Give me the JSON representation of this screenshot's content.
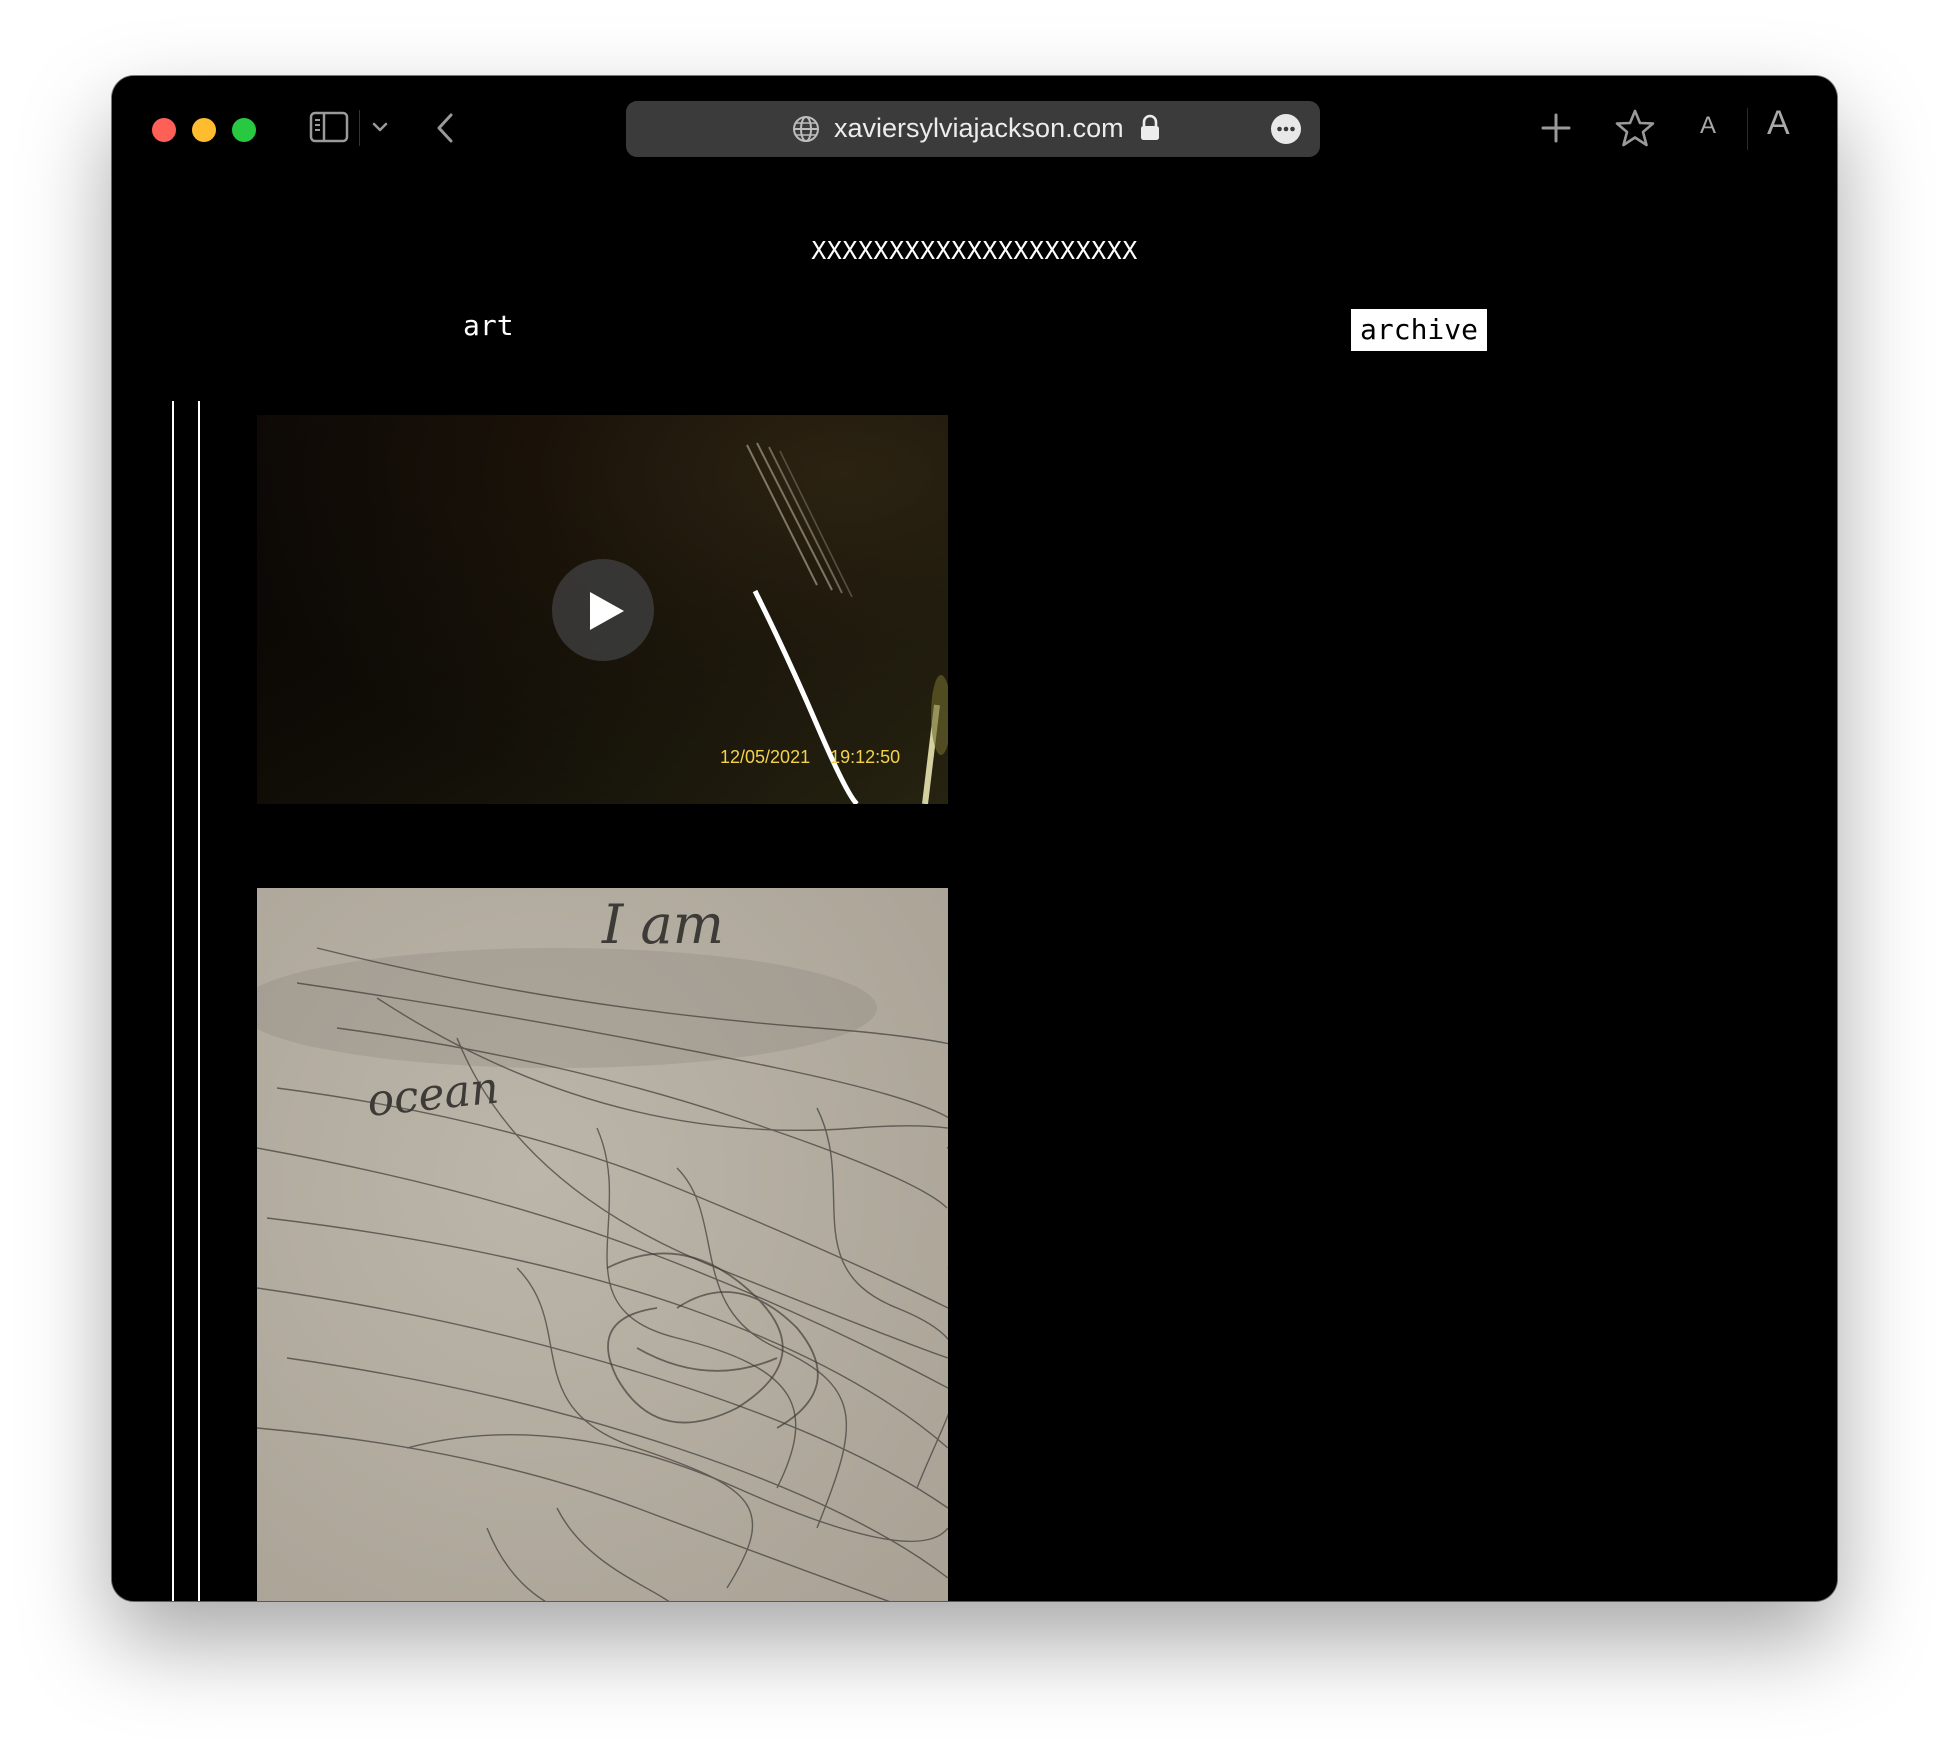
{
  "browser": {
    "url": "xaviersylviajackson.com",
    "font_small_label": "A",
    "font_large_label": "A"
  },
  "site": {
    "title": "XXXXXXXXXXXXXXXXXXXXX",
    "nav": {
      "art_label": "art",
      "archive_label": "archive"
    }
  },
  "media": {
    "video": {
      "timestamp_date": "12/05/2021",
      "timestamp_time": "19:12:50"
    },
    "drawing": {
      "handwritten_top": "I am",
      "handwritten_left": "ocean"
    }
  }
}
